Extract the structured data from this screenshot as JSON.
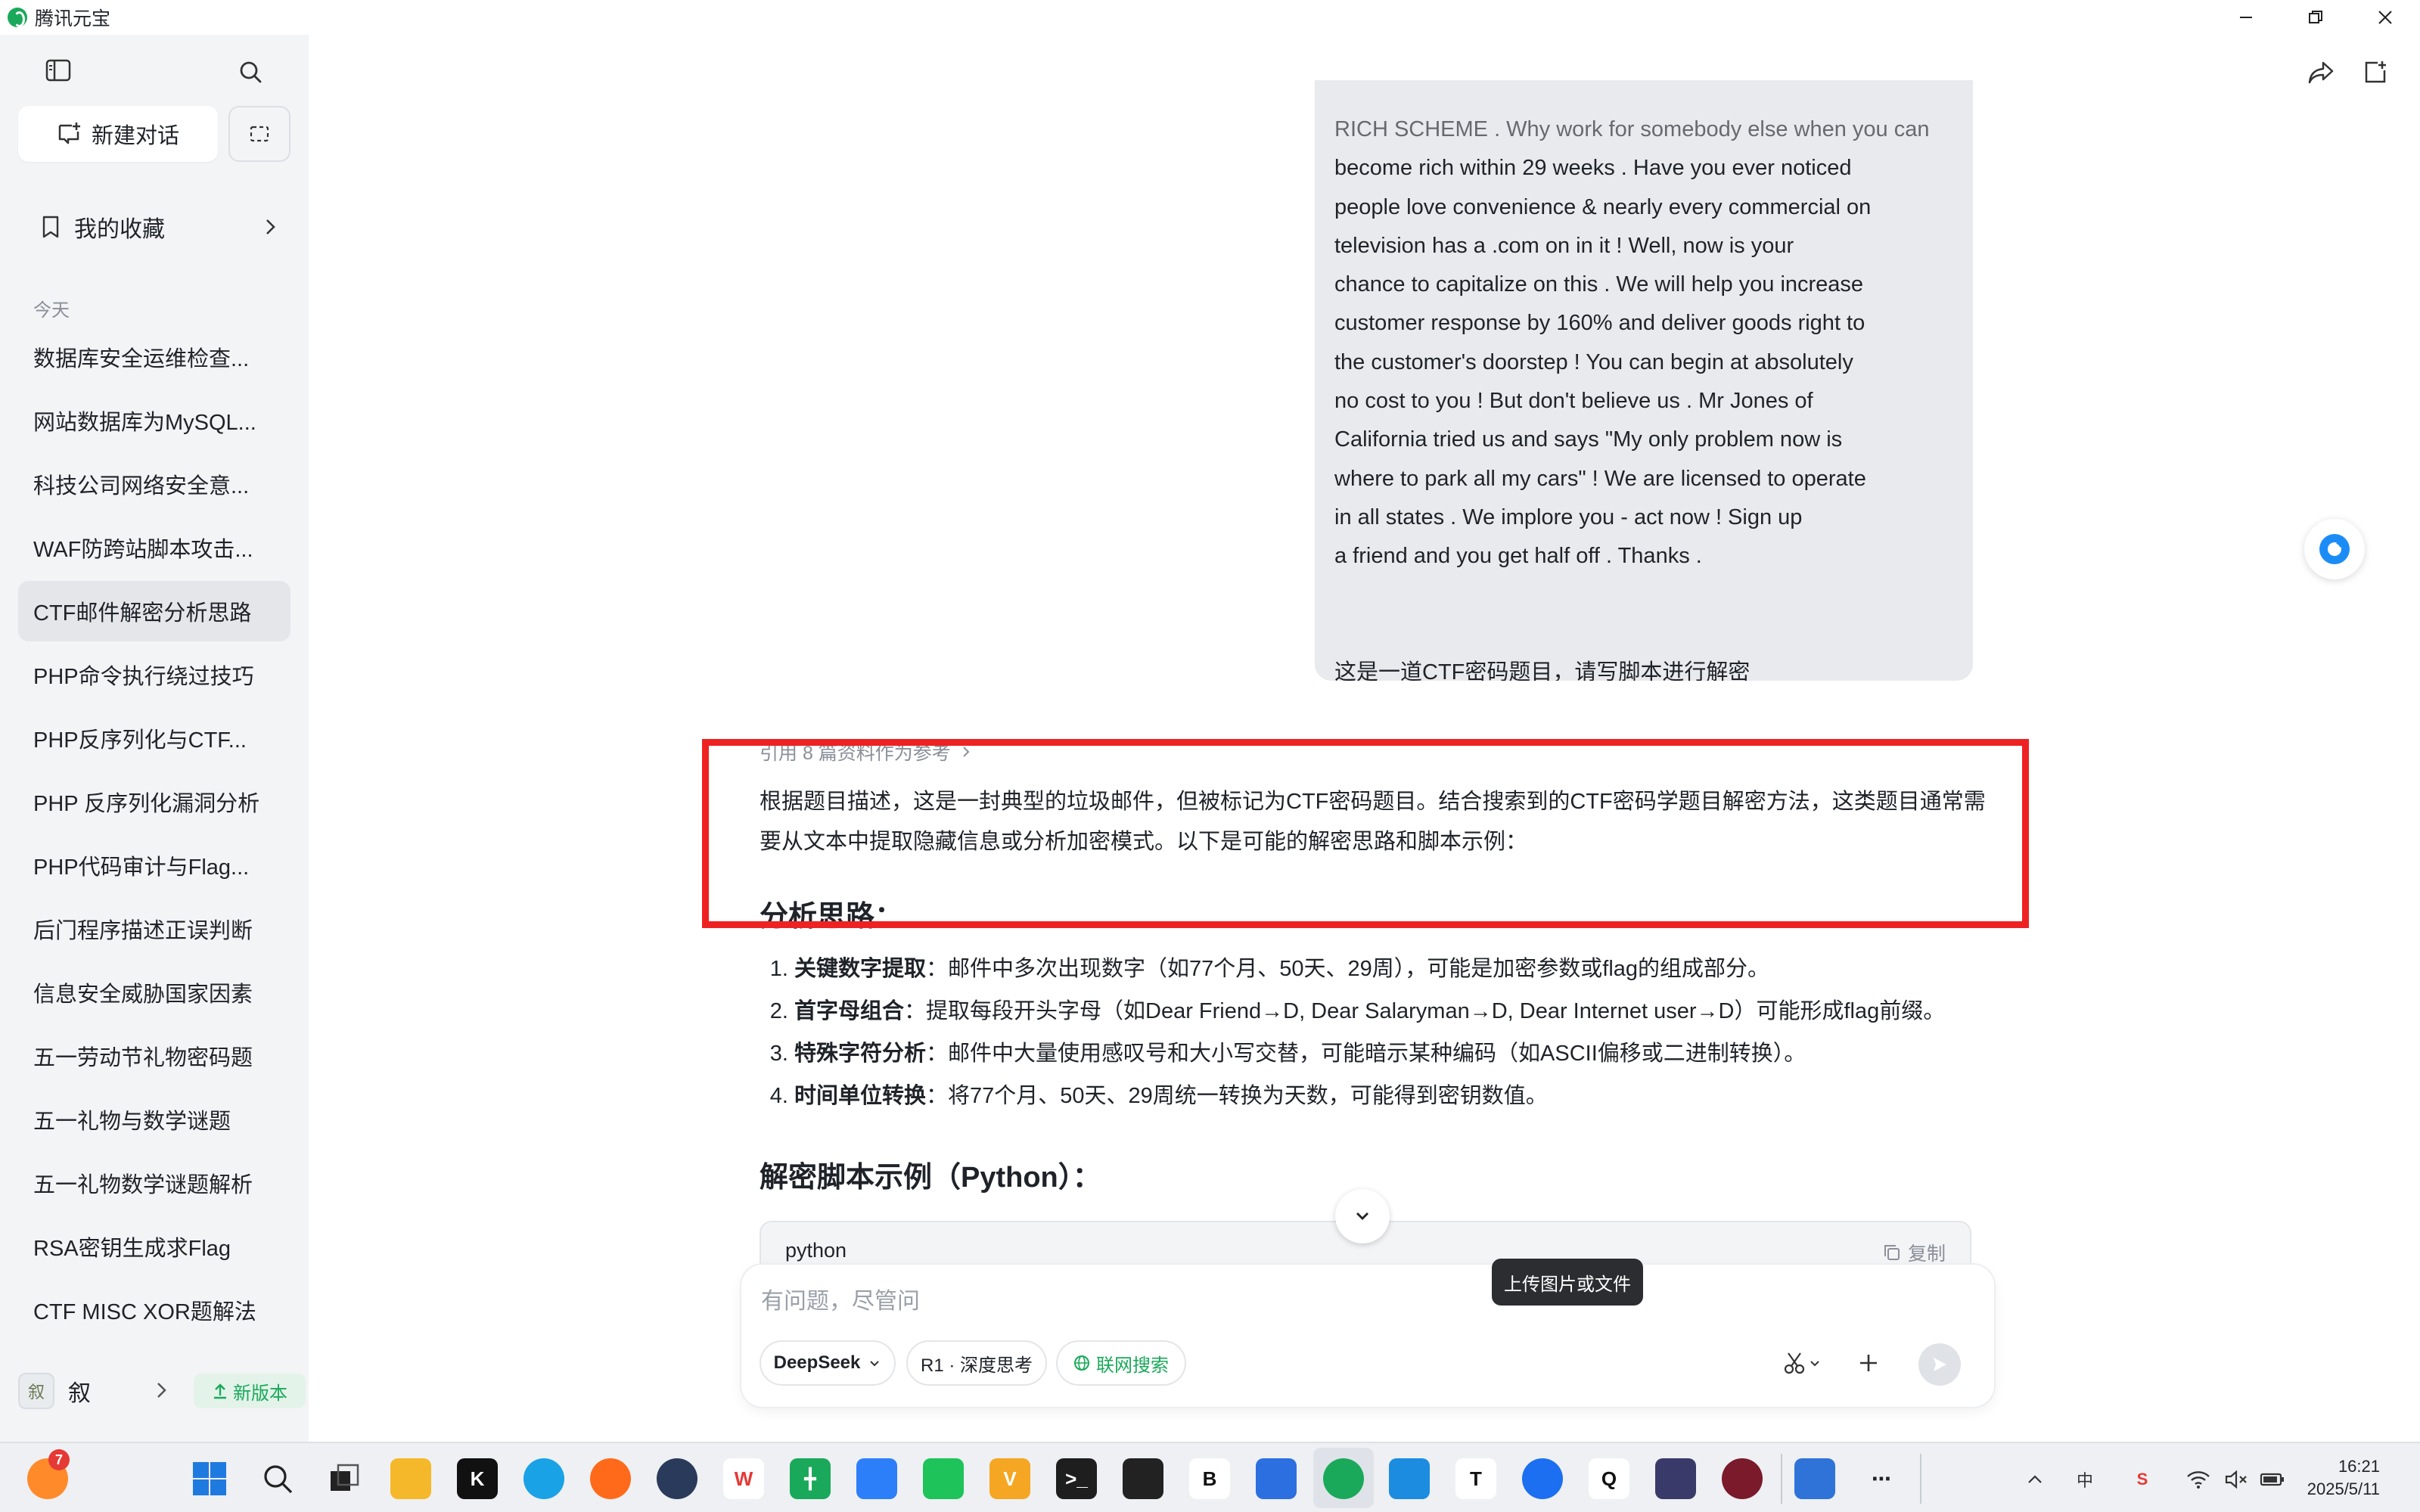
{
  "window": {
    "title": "腾讯元宝"
  },
  "sidebar": {
    "new_chat": "新建对话",
    "favorites": "我的收藏",
    "section_today": "今天",
    "conversations": [
      {
        "label": "数据库安全运维检查..."
      },
      {
        "label": "网站数据库为MySQL..."
      },
      {
        "label": "科技公司网络安全意..."
      },
      {
        "label": "WAF防跨站脚本攻击..."
      },
      {
        "label": "CTF邮件解密分析思路"
      },
      {
        "label": "PHP命令执行绕过技巧"
      },
      {
        "label": "PHP反序列化与CTF..."
      },
      {
        "label": "PHP 反序列化漏洞分析"
      },
      {
        "label": "PHP代码审计与Flag..."
      },
      {
        "label": "后门程序描述正误判断"
      },
      {
        "label": "信息安全威胁国家因素"
      },
      {
        "label": "五一劳动节礼物密码题"
      },
      {
        "label": "五一礼物与数学谜题"
      },
      {
        "label": "五一礼物数学谜题解析"
      },
      {
        "label": "RSA密钥生成求Flag"
      },
      {
        "label": "CTF MISC XOR题解法"
      }
    ],
    "active_index": 4,
    "user_name": "叙",
    "avatar_text": "叙",
    "new_version": "新版本"
  },
  "chat": {
    "user_message_lines": [
      "RICH SCHEME . Why work for somebody else when you can",
      "become rich within 29 weeks . Have you ever noticed",
      "people love convenience & nearly every commercial on",
      "television has a .com on in it ! Well, now is your",
      "chance to capitalize on this . We will help you increase",
      "customer response by 160% and deliver goods right to",
      "the customer's doorstep ! You can begin at absolutely",
      "no cost to you ! But don't believe us . Mr Jones of",
      "California tried us and says \"My only problem now is",
      "where to park all my cars\" ! We are licensed to operate",
      "in all states . We implore you - act now ! Sign up",
      "a friend and you get half off . Thanks ."
    ],
    "user_request": "这是一道CTF密码题目，请写脚本进行解密",
    "references": "引用 8 篇资料作为参考",
    "answer_intro": "根据题目描述，这是一封典型的垃圾邮件，但被标记为CTF密码题目。结合搜索到的CTF密码学题目解密方法，这类题目通常需要从文本中提取隐藏信息或分析加密模式。以下是可能的解密思路和脚本示例：",
    "heading_analysis": "分析思路：",
    "analysis_items": [
      {
        "title": "关键数字提取",
        "text": "：邮件中多次出现数字（如77个月、50天、29周），可能是加密参数或flag的组成部分。"
      },
      {
        "title": "首字母组合",
        "text": "：提取每段开头字母（如Dear Friend→D, Dear Salaryman→D, Dear Internet user→D）可能形成flag前缀。"
      },
      {
        "title": "特殊字符分析",
        "text": "：邮件中大量使用感叹号和大小写交替，可能暗示某种编码（如ASCII偏移或二进制转换）。"
      },
      {
        "title": "时间单位转换",
        "text": "：将77个月、50天、29周统一转换为天数，可能得到密钥数值。"
      }
    ],
    "heading_script": "解密脚本示例（Python）：",
    "code_lang": "python",
    "copy_label": "复制"
  },
  "composer": {
    "placeholder": "有问题，尽管问",
    "model": "DeepSeek",
    "deep_think": "R1 · 深度思考",
    "web_search": "联网搜索",
    "upload_tooltip": "上传图片或文件"
  },
  "taskbar": {
    "notification_count": "7",
    "time": "16:21",
    "date": "2025/5/11",
    "ime": "中"
  }
}
